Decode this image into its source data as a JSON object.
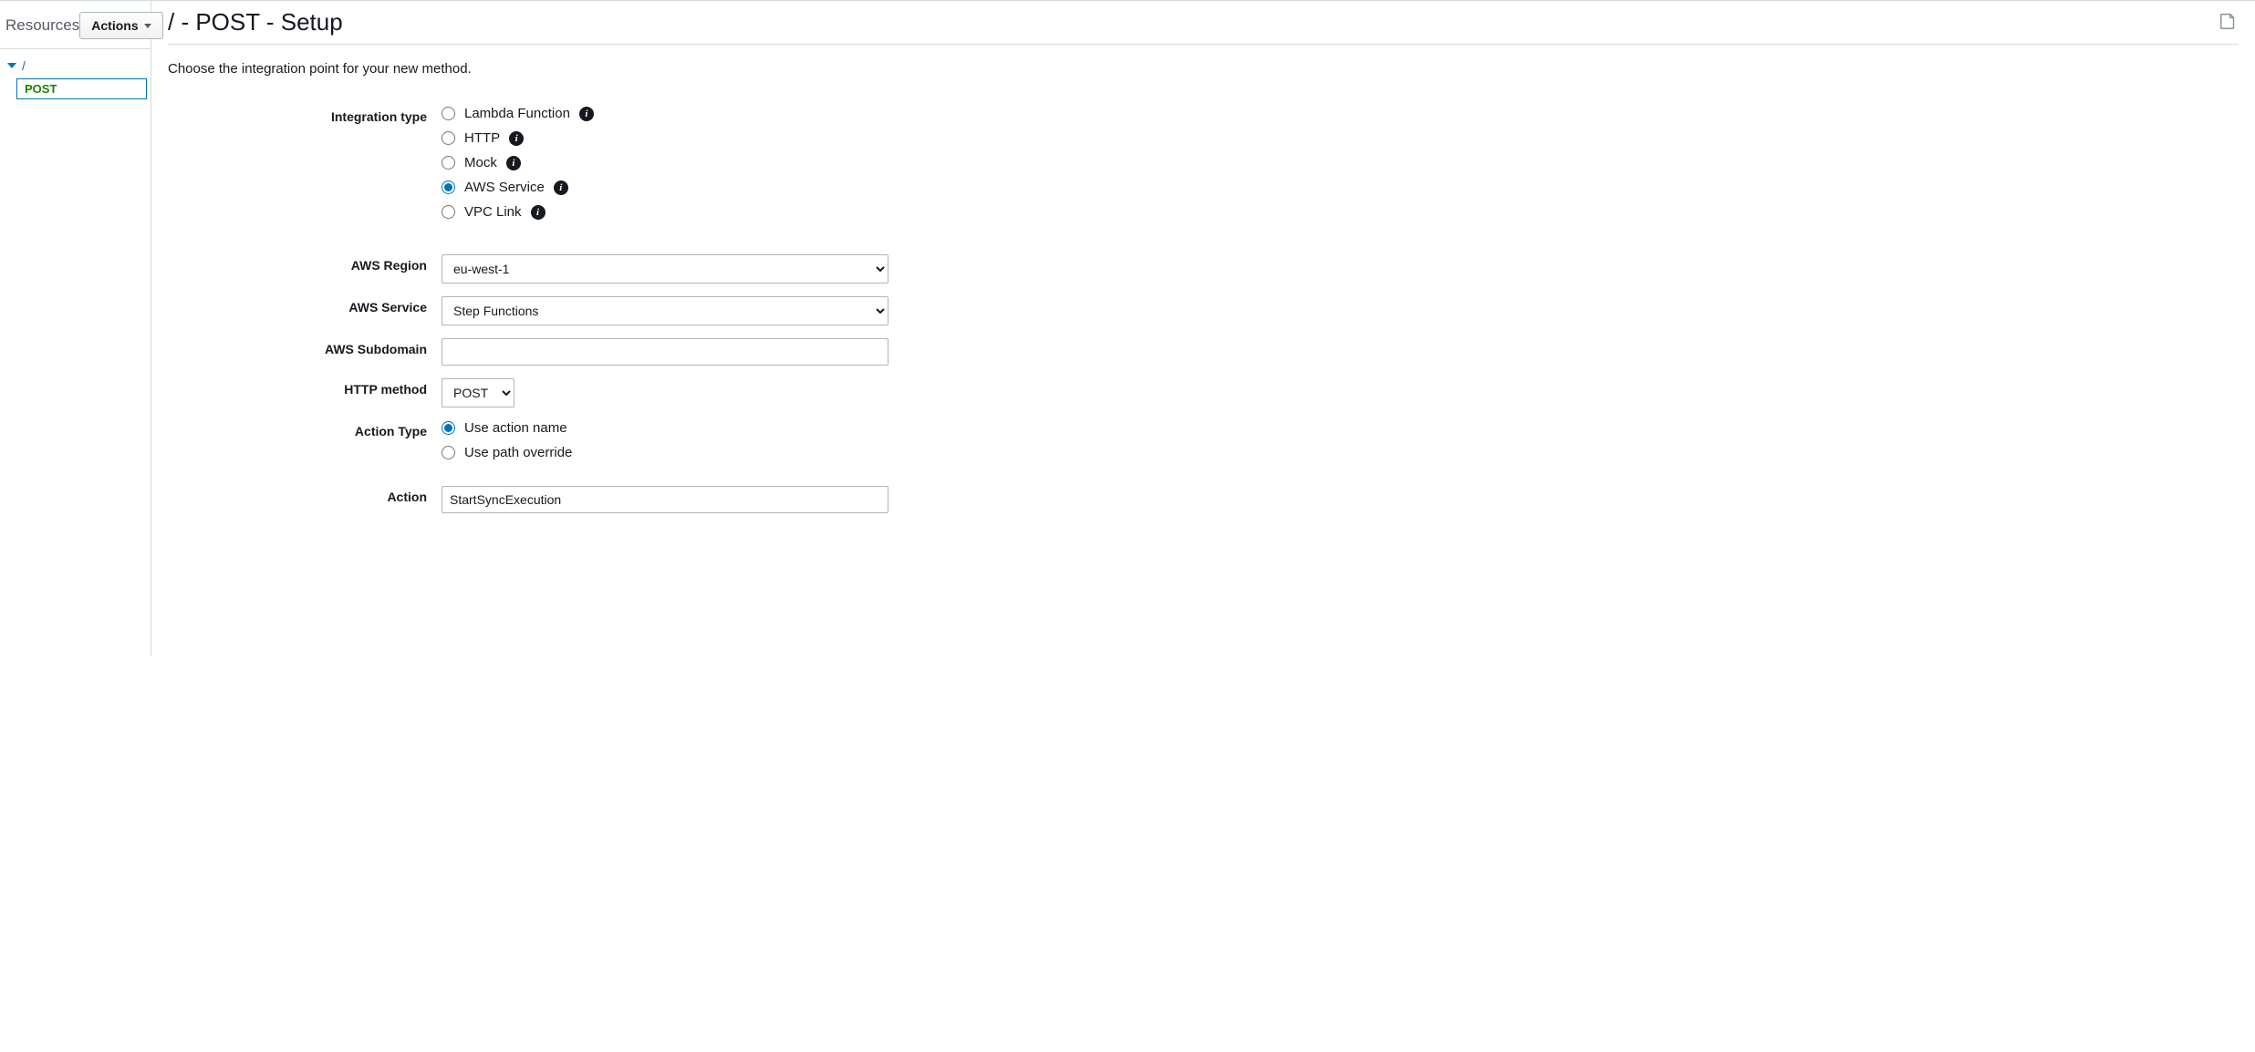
{
  "sidebar": {
    "title": "Resources",
    "actions_label": "Actions",
    "tree": {
      "root": "/",
      "method": "POST"
    }
  },
  "header": {
    "title": "/ - POST - Setup"
  },
  "subtitle": "Choose the integration point for your new method.",
  "form": {
    "integration_type": {
      "label": "Integration type",
      "options": [
        {
          "label": "Lambda Function",
          "checked": false
        },
        {
          "label": "HTTP",
          "checked": false
        },
        {
          "label": "Mock",
          "checked": false
        },
        {
          "label": "AWS Service",
          "checked": true
        },
        {
          "label": "VPC Link",
          "checked": false
        }
      ]
    },
    "aws_region": {
      "label": "AWS Region",
      "value": "eu-west-1"
    },
    "aws_service": {
      "label": "AWS Service",
      "value": "Step Functions"
    },
    "aws_subdomain": {
      "label": "AWS Subdomain",
      "value": ""
    },
    "http_method": {
      "label": "HTTP method",
      "value": "POST"
    },
    "action_type": {
      "label": "Action Type",
      "options": [
        {
          "label": "Use action name",
          "checked": true
        },
        {
          "label": "Use path override",
          "checked": false
        }
      ]
    },
    "action": {
      "label": "Action",
      "value": "StartSyncExecution"
    }
  },
  "info_glyph": "i"
}
